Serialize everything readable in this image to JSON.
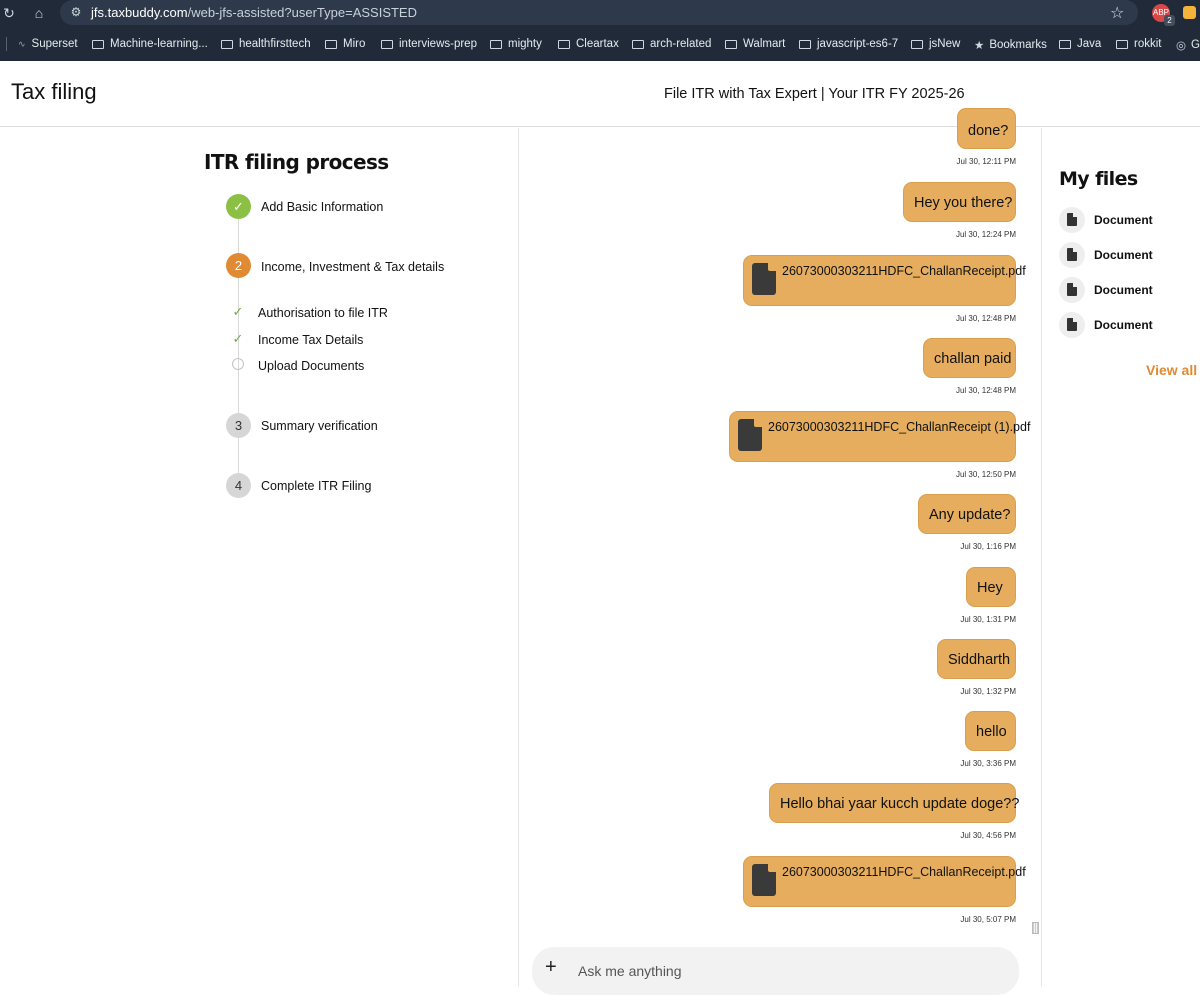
{
  "browser": {
    "url_host": "jfs.taxbuddy.com",
    "url_path": "/web-jfs-assisted?userType=ASSISTED",
    "extension_badge_count": "2",
    "bookmarks": [
      "Superset",
      "Machine-learning...",
      "healthfirsttech",
      "Miro",
      "interviews-prep",
      "mighty",
      "Cleartax",
      "arch-related",
      "Walmart",
      "javascript-es6-7",
      "jsNew",
      "Bookmarks",
      "Java",
      "rokkit",
      "G"
    ]
  },
  "header": {
    "title": "Tax filing",
    "subtitle": "File ITR with Tax Expert | Your ITR FY 2025-26"
  },
  "process": {
    "title": "ITR filing process",
    "steps": [
      {
        "marker": "✓",
        "label": "Add Basic Information",
        "status": "done"
      },
      {
        "marker": "2",
        "label": "Income, Investment & Tax details",
        "status": "active"
      },
      {
        "marker": "3",
        "label": "Summary verification",
        "status": "pending"
      },
      {
        "marker": "4",
        "label": "Complete ITR Filing",
        "status": "pending"
      }
    ],
    "substeps": [
      {
        "label": "Authorisation to file ITR",
        "status": "done"
      },
      {
        "label": "Income Tax Details",
        "status": "done"
      },
      {
        "label": "Upload Documents",
        "status": "pending"
      }
    ]
  },
  "chat": {
    "messages": [
      {
        "type": "text",
        "text": "done?",
        "time": "Jul 30, 12:11 PM"
      },
      {
        "type": "text",
        "text": "Hey you there?",
        "time": "Jul 30, 12:24 PM"
      },
      {
        "type": "file",
        "text": "26073000303211HDFC_ChallanReceipt.pdf",
        "time": "Jul 30, 12:48 PM"
      },
      {
        "type": "text",
        "text": "challan paid",
        "time": "Jul 30, 12:48 PM"
      },
      {
        "type": "file",
        "text": "26073000303211HDFC_ChallanReceipt (1).pdf",
        "time": "Jul 30, 12:50 PM"
      },
      {
        "type": "text",
        "text": "Any update?",
        "time": "Jul 30, 1:16 PM"
      },
      {
        "type": "text",
        "text": "Hey",
        "time": "Jul 30, 1:31 PM"
      },
      {
        "type": "text",
        "text": "Siddharth",
        "time": "Jul 30, 1:32 PM"
      },
      {
        "type": "text",
        "text": "hello",
        "time": "Jul 30, 3:36 PM"
      },
      {
        "type": "text",
        "text": "Hello bhai yaar kucch update doge??",
        "time": "Jul 30, 4:56 PM"
      },
      {
        "type": "file",
        "text": "26073000303211HDFC_ChallanReceipt.pdf",
        "time": "Jul 30, 5:07 PM"
      }
    ],
    "input_placeholder": "Ask me anything",
    "add_label": "+"
  },
  "files": {
    "title": "My files",
    "documents": [
      "Document",
      "Document",
      "Document",
      "Document"
    ],
    "view_all": "View all d"
  },
  "colors": {
    "bubble": "#e5ad5d",
    "step_done": "#8cc045",
    "step_active": "#e08a33",
    "view_all": "#e08a33"
  }
}
